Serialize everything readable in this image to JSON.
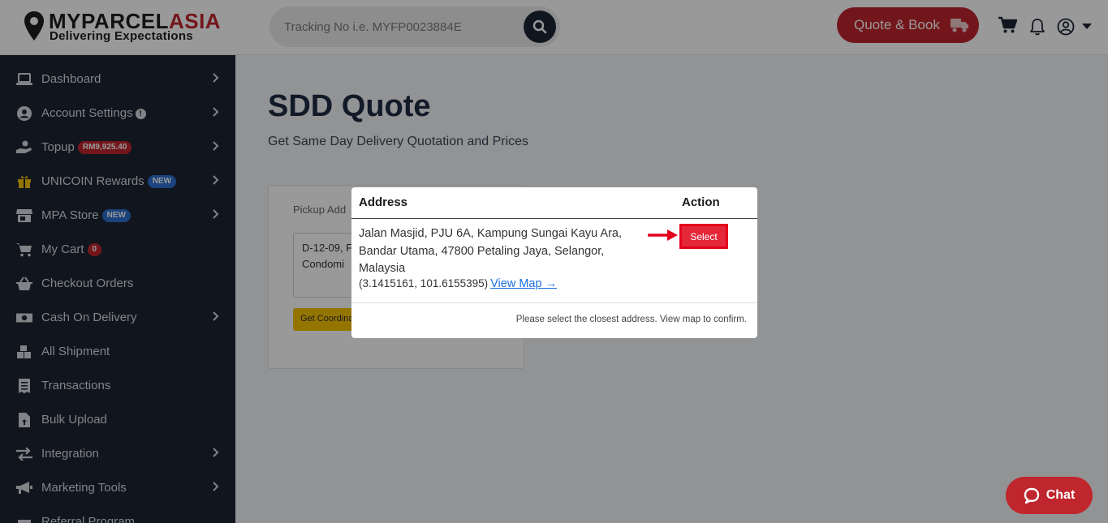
{
  "brand": {
    "name_main": "MYPARCEL",
    "name_accent": "ASIA",
    "tagline": "Delivering Expectations",
    "accent_color": "#c0262d"
  },
  "search": {
    "placeholder": "Tracking No i.e. MYFP0023884E",
    "icon": "search-icon"
  },
  "header": {
    "quote_label": "Quote & Book",
    "icons": [
      "truck-icon",
      "cart-icon",
      "bell-icon",
      "user-icon",
      "caret-down-icon"
    ]
  },
  "sidebar": {
    "items": [
      {
        "label": "Dashboard",
        "icon": "laptop-icon",
        "chevron": true
      },
      {
        "label": "Account Settings",
        "icon": "user-circle-icon",
        "chevron": true,
        "info": "!"
      },
      {
        "label": "Topup",
        "icon": "hand-coin-icon",
        "chevron": true,
        "badge": "RM9,925.40"
      },
      {
        "label": "UNICOIN Rewards",
        "icon": "gift-icon",
        "chevron": true,
        "badge": "NEW"
      },
      {
        "label": "MPA Store",
        "icon": "store-icon",
        "chevron": true,
        "badge": "NEW"
      },
      {
        "label": "My Cart",
        "icon": "cart-plus-icon",
        "chevron": false,
        "badge": "0"
      },
      {
        "label": "Checkout Orders",
        "icon": "basket-icon",
        "chevron": false
      },
      {
        "label": "Cash On Delivery",
        "icon": "money-icon",
        "chevron": true
      },
      {
        "label": "All Shipment",
        "icon": "boxes-icon",
        "chevron": false
      },
      {
        "label": "Transactions",
        "icon": "receipt-icon",
        "chevron": false
      },
      {
        "label": "Bulk Upload",
        "icon": "file-upload-icon",
        "chevron": false
      },
      {
        "label": "Integration",
        "icon": "arrows-exchange-icon",
        "chevron": true
      },
      {
        "label": "Marketing Tools",
        "icon": "megaphone-icon",
        "chevron": true
      },
      {
        "label": "Referral Program",
        "icon": "gift-icon",
        "chevron": false
      }
    ]
  },
  "main": {
    "title": "SDD Quote",
    "subtitle": "Get Same Day Delivery Quotation and Prices",
    "card": {
      "label": "Pickup Add",
      "address_value": "D-12-09, F\nCondomi",
      "button_label": "Get Coordinates"
    }
  },
  "modal": {
    "col_address": "Address",
    "col_action": "Action",
    "address_text": "Jalan Masjid, PJU 6A, Kampung Sungai Kayu Ara, Bandar Utama, 47800 Petaling Jaya, Selangor, Malaysia",
    "coordinates": "(3.1415161, 101.6155395)",
    "view_map_label": "View Map →",
    "select_label": "Select",
    "footer_note": "Please select the closest address. View map to confirm.",
    "highlight_color": "#e4001b"
  },
  "chat": {
    "label": "Chat",
    "icon": "chat-bubble-icon"
  }
}
